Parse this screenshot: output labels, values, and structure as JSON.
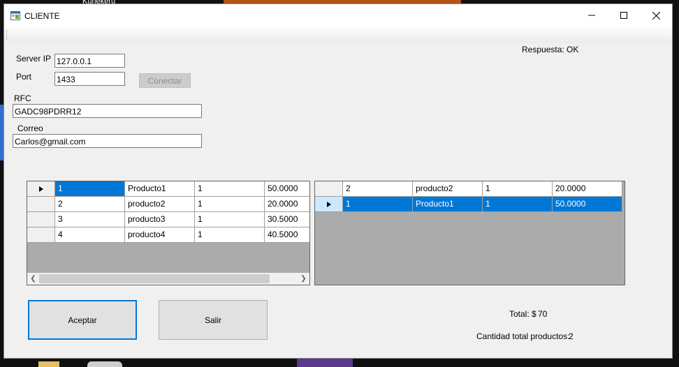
{
  "window": {
    "title": "CLIENTE"
  },
  "desktop": {
    "label_fragment": "Kuriekeru"
  },
  "connection": {
    "server_ip_label": "Server IP",
    "server_ip_value": "127.0.0.1",
    "port_label": "Port",
    "port_value": "1433",
    "connect_button": "Conectar"
  },
  "response_status": "Respuesta: OK",
  "customer": {
    "rfc_label": "RFC",
    "rfc_value": "GADC98PDRR12",
    "email_label": "Correo",
    "email_value": "Carlos@gmail.com"
  },
  "catalog_grid": {
    "rows": [
      {
        "id": "1",
        "name": "Producto1",
        "qty": "1",
        "price": "50.0000"
      },
      {
        "id": "2",
        "name": "producto2",
        "qty": "1",
        "price": "20.0000"
      },
      {
        "id": "3",
        "name": "producto3",
        "qty": "1",
        "price": "30.5000"
      },
      {
        "id": "4",
        "name": "producto4",
        "qty": "1",
        "price": "40.5000"
      }
    ]
  },
  "cart_grid": {
    "rows": [
      {
        "id": "2",
        "name": "producto2",
        "qty": "1",
        "price": "20.0000"
      },
      {
        "id": "1",
        "name": "Producto1",
        "qty": "1",
        "price": "50.0000"
      }
    ]
  },
  "buttons": {
    "accept": "Aceptar",
    "exit": "Salir"
  },
  "totals": {
    "total_label": "Total: $",
    "total_value": "70",
    "count_label": "Cantidad total productos:",
    "count_value": "2"
  },
  "colors": {
    "selection": "#0078d7",
    "accent_border": "#0078d7"
  }
}
